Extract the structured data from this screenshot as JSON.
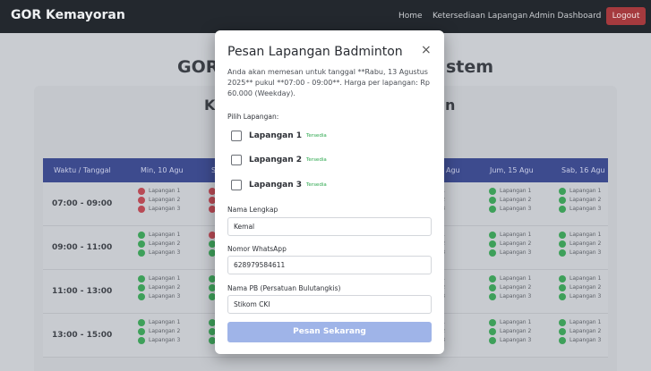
{
  "navbar": {
    "brand": "GOR Kemayoran",
    "links": [
      "Home",
      "Ketersediaan Lapangan",
      "Admin Dashboard"
    ],
    "logout": "Logout"
  },
  "page": {
    "hero_left": "GOR",
    "hero_right": "stem",
    "sub_left": "K",
    "sub_right": "n"
  },
  "table": {
    "headers": [
      "Waktu / Tanggal",
      "Min, 10 Agu",
      "S",
      "Agu",
      "Jum, 15 Agu",
      "Sab, 16 Agu"
    ],
    "rows": [
      {
        "time": "07:00 - 09:00"
      },
      {
        "time": "09:00 - 11:00"
      },
      {
        "time": "11:00 - 13:00"
      },
      {
        "time": "13:00 - 15:00"
      }
    ],
    "court_labels": [
      "Lapangan 1",
      "Lapangan 2",
      "Lapangan 3"
    ],
    "partial_labels": [
      "gan 1",
      "gan 2",
      "gan 3"
    ],
    "colors": {
      "available": "#3ea05a",
      "booked": "#b84a55"
    }
  },
  "modal": {
    "title": "Pesan Lapangan Badminton",
    "close": "×",
    "description": "Anda akan memesan untuk tanggal **Rabu, 13 Agustus 2025** pukul **07:00 - 09:00**. Harga per lapangan: Rp 60.000 (Weekday).",
    "court_label": "Pilih Lapangan:",
    "courts": [
      {
        "name": "Lapangan 1",
        "status": "Tersedia"
      },
      {
        "name": "Lapangan 2",
        "status": "Tersedia"
      },
      {
        "name": "Lapangan 3",
        "status": "Tersedia"
      }
    ],
    "name_label": "Nama Lengkap",
    "name_value": "Kemal",
    "wa_label": "Nomor WhatsApp",
    "wa_value": "628979584611",
    "pb_label": "Nama PB (Persatuan Bulutangkis)",
    "pb_value": "Stikom CKI",
    "submit": "Pesan Sekarang"
  }
}
